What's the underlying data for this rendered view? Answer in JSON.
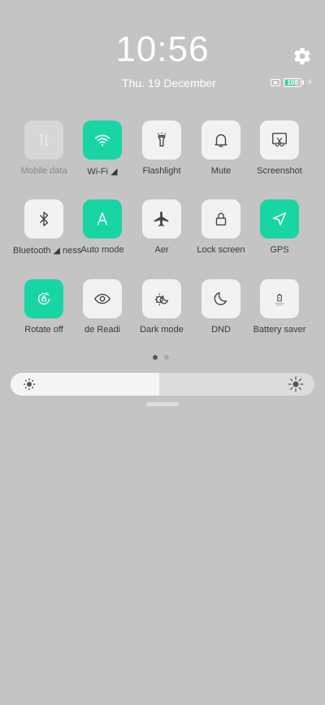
{
  "clock": {
    "time": "10:56",
    "date": "Thu. 19 December"
  },
  "status": {
    "battery_text": "100",
    "battery_color": "#3cd99c"
  },
  "colors": {
    "accent": "#18d6a4",
    "background": "#c4c4c4"
  },
  "brightness": {
    "level_fraction": 0.49
  },
  "pager": {
    "current": 1,
    "total": 2
  },
  "rows": [
    [
      {
        "id": "mobile-data",
        "label": "Mobile data",
        "icon": "mobile-data-icon",
        "state": "disabled"
      },
      {
        "id": "wifi",
        "label": "Wi-Fi ◢",
        "icon": "wifi-icon",
        "state": "on"
      },
      {
        "id": "flashlight",
        "label": "Flashlight",
        "icon": "flashlight-icon",
        "state": "off"
      },
      {
        "id": "mute",
        "label": "Mute",
        "icon": "bell-icon",
        "state": "off"
      },
      {
        "id": "screenshot",
        "label": "Screenshot",
        "icon": "screenshot-icon",
        "state": "off"
      }
    ],
    [
      {
        "id": "bluetooth",
        "label": "Bluetooth ◢ ness",
        "icon": "bluetooth-icon",
        "state": "off"
      },
      {
        "id": "auto-mode",
        "label": "Auto mode",
        "icon": "auto-brightness-icon",
        "state": "on"
      },
      {
        "id": "aeroplane",
        "label": "Aer",
        "icon": "airplane-icon",
        "state": "off"
      },
      {
        "id": "lock-screen",
        "label": "Lock screen",
        "icon": "lock-icon",
        "state": "off"
      },
      {
        "id": "gps",
        "label": "GPS",
        "icon": "location-arrow-icon",
        "state": "on"
      }
    ],
    [
      {
        "id": "rotate",
        "label": "Rotate off",
        "icon": "rotate-lock-icon",
        "state": "on"
      },
      {
        "id": "reading",
        "label": "de        Readi",
        "icon": "eye-icon",
        "state": "off"
      },
      {
        "id": "dark-mode",
        "label": "Dark mode",
        "icon": "dark-mode-icon",
        "state": "off"
      },
      {
        "id": "dnd",
        "label": "DND",
        "icon": "moon-icon",
        "state": "off"
      },
      {
        "id": "battery-saver",
        "label": "Battery saver",
        "icon": "battery-saver-icon",
        "state": "off"
      }
    ]
  ]
}
